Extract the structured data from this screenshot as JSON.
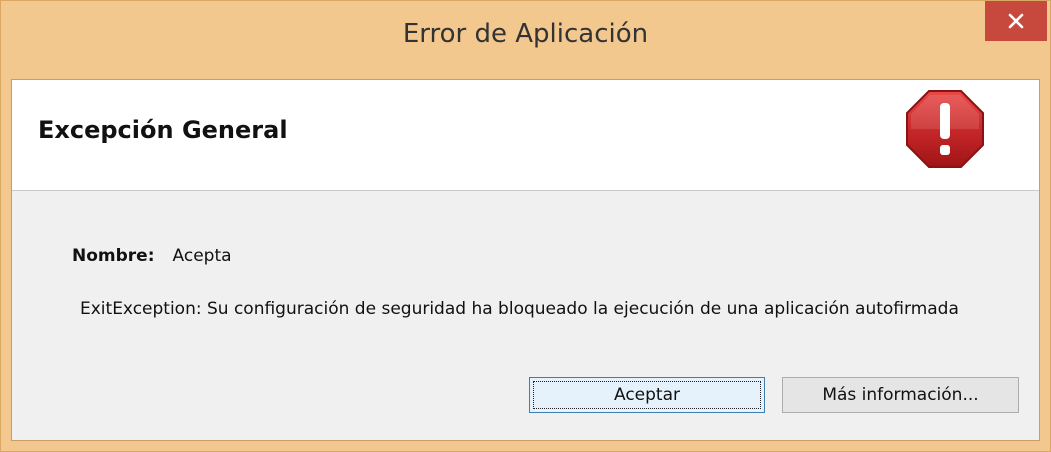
{
  "window": {
    "title": "Error de Aplicación",
    "close_icon": "close-icon"
  },
  "header": {
    "title": "Excepción General",
    "icon": "error-stop-icon",
    "icon_color": "#c8282a"
  },
  "details": {
    "name_label": "Nombre:",
    "name_value": "Acepta",
    "message": "ExitException: Su configuración de seguridad ha bloqueado la ejecución de una aplicación autofirmada"
  },
  "buttons": {
    "accept_label": "Aceptar",
    "more_info_label": "Más información..."
  },
  "colors": {
    "frame": "#f3c88f",
    "close_button": "#c7483d",
    "content_bg": "#f0f0f0",
    "header_bg": "#ffffff",
    "default_button_border": "#3c7fb1"
  }
}
